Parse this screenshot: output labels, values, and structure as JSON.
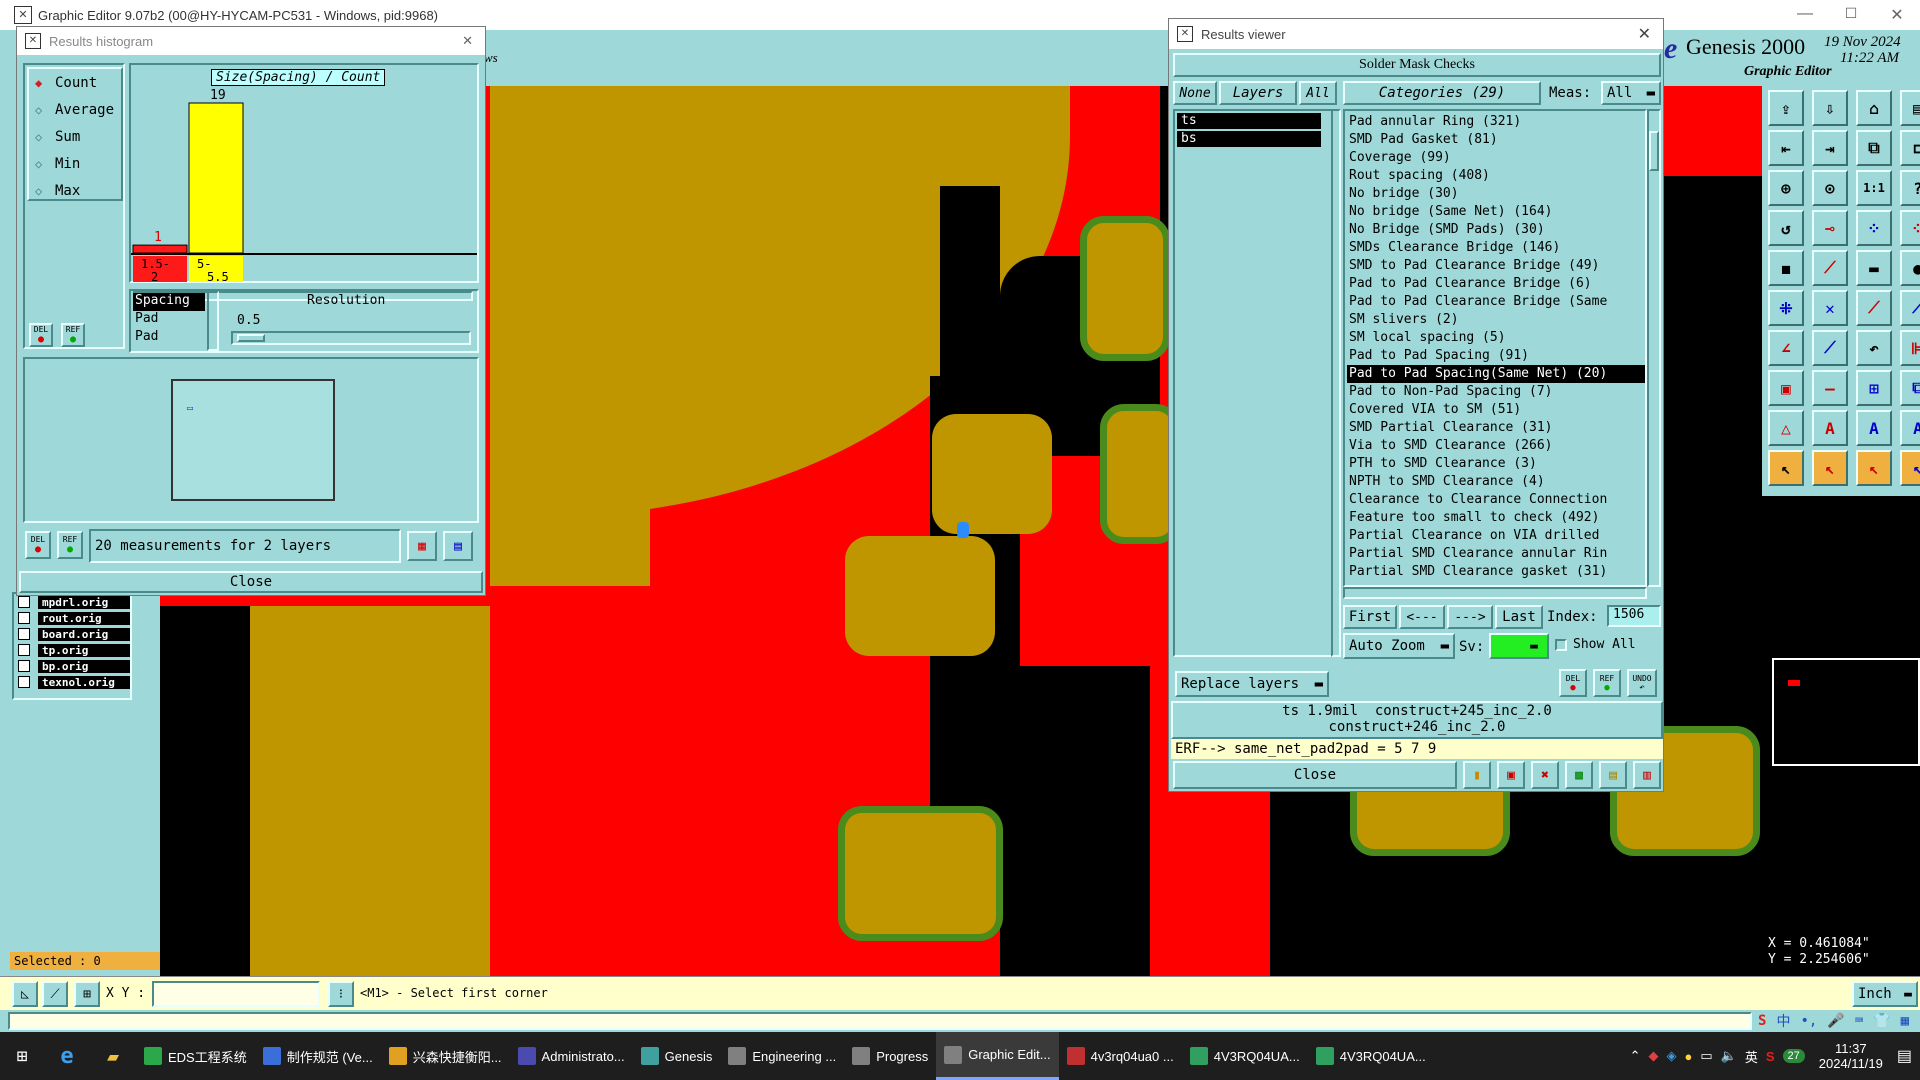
{
  "app": {
    "title": "Graphic Editor 9.07b2 (00@HY-HYCAM-PC531 - Windows, pid:9968)",
    "genesis_title": "Genesis 2000",
    "genesis_date": "19 Nov 2024",
    "genesis_time": "11:22 AM",
    "genesis_sub": "Graphic Editor"
  },
  "histogram": {
    "title": "Results histogram",
    "options": [
      "Count",
      "Average",
      "Sum",
      "Min",
      "Max"
    ],
    "selected_option": "Count",
    "chart_header": "Size(Spacing) / Count",
    "bars": [
      {
        "label": "1.5-2",
        "count": 1,
        "color": "#ff1a1a"
      },
      {
        "label": "5-5.5",
        "count": 19,
        "color": "#ffff00"
      }
    ],
    "bar_label_1": "1.5-",
    "bar_label_1b": "2",
    "bar_label_2": "5-",
    "bar_label_2b": "5.5",
    "count_1": "1",
    "count_2": "19",
    "list": [
      "Spacing",
      "Pad",
      "Pad"
    ],
    "resolution_label": "Resolution",
    "resolution_value": "0.5",
    "measurements": "20 measurements for 2 layers",
    "del": "DEL",
    "ref": "REF",
    "close": "Close"
  },
  "layers_left": [
    "mpdrl.orig",
    "rout.orig",
    "board.orig",
    "tp.orig",
    "bp.orig",
    "texnol.orig"
  ],
  "ws_fragment": "ws",
  "selected": "Selected : 0",
  "results": {
    "title": "Results viewer",
    "header": "Solder Mask Checks",
    "none": "None",
    "layers": "Layers",
    "all": "All",
    "categories_label": "Categories (29)",
    "meas_label": "Meas:",
    "meas_value": "All",
    "layer_list": [
      "ts",
      "bs"
    ],
    "categories": [
      "Pad annular Ring (321)",
      "SMD Pad Gasket (81)",
      "Coverage (99)",
      "Rout spacing (408)",
      "No bridge (30)",
      "No bridge (Same Net) (164)",
      "No Bridge (SMD Pads) (30)",
      "SMDs Clearance Bridge (146)",
      "SMD to Pad Clearance Bridge (49)",
      "Pad to Pad Clearance Bridge (6)",
      "Pad to Pad Clearance Bridge (Same",
      "SM slivers (2)",
      "SM local spacing (5)",
      "Pad to Pad Spacing (91)",
      "Pad to Pad Spacing(Same Net) (20)",
      "Pad to Non-Pad Spacing (7)",
      "Covered VIA to SM (51)",
      "SMD Partial Clearance (31)",
      "Via to SMD Clearance (266)",
      "PTH to SMD Clearance (3)",
      "NPTH to SMD Clearance (4)",
      "Clearance to Clearance Connection",
      "Feature too small to check (492)",
      "Partial Clearance on VIA drilled",
      "Partial SMD Clearance annular Rin",
      "Partial SMD Clearance gasket (31)"
    ],
    "selected_category": "Pad to Pad Spacing(Same Net) (20)",
    "first": "First",
    "prev": "<---",
    "next": "--->",
    "last": "Last",
    "index_label": "Index:",
    "index_value": "1506",
    "auto_zoom": "Auto Zoom",
    "sv_label": "Sv:",
    "show_all": "Show All",
    "replace_layers": "Replace layers",
    "info_line1": "ts 1.9mil  construct+245_inc_2.0",
    "info_line2": "construct+246_inc_2.0",
    "erf": "ERF--> same_net_pad2pad = 5 7 9",
    "close": "Close",
    "del": "DEL",
    "ref": "REF",
    "undo": "UNDO"
  },
  "coords": {
    "x": "X = 0.461084\"",
    "y": "Y = 2.254606\""
  },
  "units": "Inch",
  "status": {
    "xy_label": "X Y :",
    "xy_value": "",
    "message": "<M1> - Select first corner"
  },
  "taskbar": {
    "items": [
      {
        "label": "EDS工程系统",
        "color": "#2aa84a"
      },
      {
        "label": "制作规范 (Ve...",
        "color": "#3a6fd8"
      },
      {
        "label": "兴森快捷衡阳...",
        "color": "#e0a020"
      },
      {
        "label": "Administrato...",
        "color": "#4a4ab0"
      },
      {
        "label": "Genesis",
        "color": "#40a0a0"
      },
      {
        "label": "Engineering ...",
        "color": "#808080"
      },
      {
        "label": "Progress",
        "color": "#808080"
      },
      {
        "label": "Graphic Edit...",
        "color": "#808080"
      },
      {
        "label": "4v3rq04ua0 ...",
        "color": "#c03030"
      },
      {
        "label": "4V3RQ04UA...",
        "color": "#30a060"
      },
      {
        "label": "4V3RQ04UA...",
        "color": "#30a060"
      }
    ],
    "active_index": 7,
    "time": "11:37",
    "date": "2024/11/19",
    "ime": "英",
    "notify_count": "27",
    "tray_ime": "中"
  },
  "colors": {
    "teal": "#9fd8d8",
    "pad": "#bf9600",
    "copper": "#ff0000",
    "green_ring": "#4b8b1c"
  }
}
